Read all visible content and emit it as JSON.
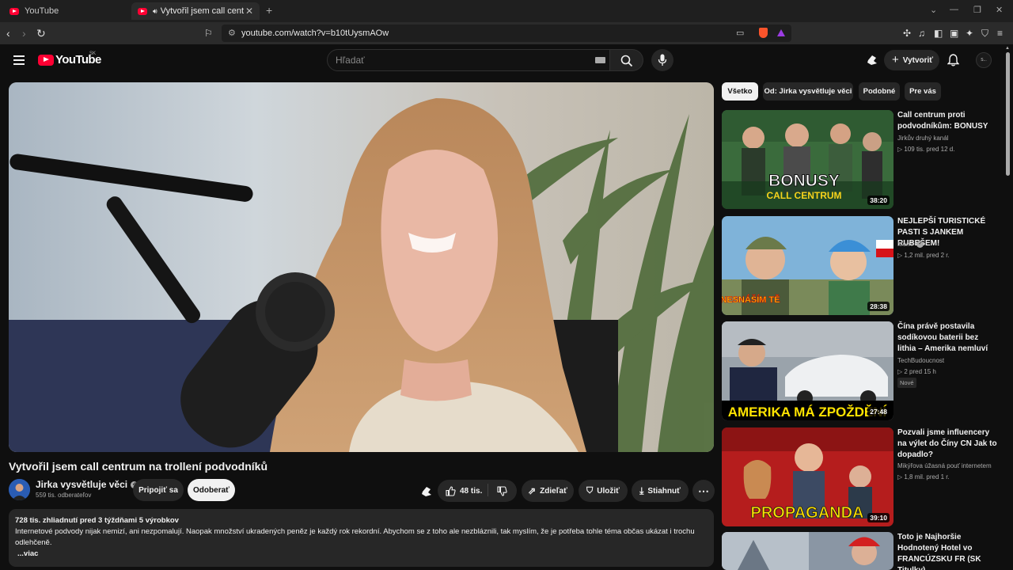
{
  "browser": {
    "tabs": [
      {
        "title": "YouTube"
      },
      {
        "title": "Vytvořil jsem call centrum na"
      }
    ],
    "url": "youtube.com/watch?v=b10tUysmAOw"
  },
  "masthead": {
    "logo_text": "YouTube",
    "region": "SK",
    "search_placeholder": "Hľadať",
    "create_label": "Vytvoriť",
    "avatar_text": "S..."
  },
  "video": {
    "title": "Vytvořil jsem call centrum na trollení podvodníků",
    "channel": {
      "name": "Jirka vysvětluje věci",
      "subscribers": "559 tis. odberateľov"
    },
    "join_label": "Pripojiť sa",
    "subscribe_label": "Odoberať",
    "likes": "48 tis.",
    "share_label": "Zdieľať",
    "save_label": "Uložiť",
    "download_label": "Stiahnuť"
  },
  "description": {
    "meta": "728 tis. zhliadnutí  pred 3 týždňami  5 výrobkov",
    "text": "Internetové podvody nijak nemizí, ani nezpomalují. Naopak množství ukradených peněz je každý rok rekordní. Abychom se z toho ale nezbláznili, tak myslím, že je potřeba tohle téma občas ukázat i trochu odlehčeně.",
    "more": "...viac"
  },
  "chips": [
    {
      "label": "Všetko",
      "active": true
    },
    {
      "label": "Od: Jirka vysvětluje věci",
      "active": false
    },
    {
      "label": "Podobné",
      "active": false
    },
    {
      "label": "Pre vás",
      "active": false
    }
  ],
  "recommendations": [
    {
      "title": "Call centrum proti podvodníkům: BONUSY",
      "channel": "Jirkův druhý kanál",
      "stats": "▷ 109 tis.   pred 12 d.",
      "duration": "38:20",
      "thumb_text": "BONUSY",
      "thumb_subtext": "CALL CENTRUM"
    },
    {
      "title": "NEJLEPŠÍ TURISTICKÉ PASTI S JANKEM RUBEŠEM!",
      "channel": "MenT",
      "stats": "▷ 1,2 mil.   pred 2 r.",
      "duration": "28:38",
      "thumb_text": "NESNÁŠÍM TĚ"
    },
    {
      "title": "Čína právě postavila sodíkovou baterii bez lithia – Amerika nemluví",
      "channel": "TechBudoucnost",
      "stats": "▷ 2   pred 15 h",
      "badge": "Nové",
      "duration": "27:48",
      "thumb_text": "AMERIKA MÁ ZPOŽDĚNÍ"
    },
    {
      "title": "Pozvali jsme influencery na výlet do Číny CN Jak to dopadlo?",
      "channel": "Mikýřova úžasná pouť internetem",
      "stats": "▷ 1,8 mil.   pred 1 r.",
      "duration": "39:10",
      "thumb_text": "PROPAGANDA"
    },
    {
      "title": "Toto je Najhoršie Hodnotený Hotel vo FRANCÚZSKU FR (SK Titulky)",
      "channel": "",
      "stats": ""
    }
  ]
}
